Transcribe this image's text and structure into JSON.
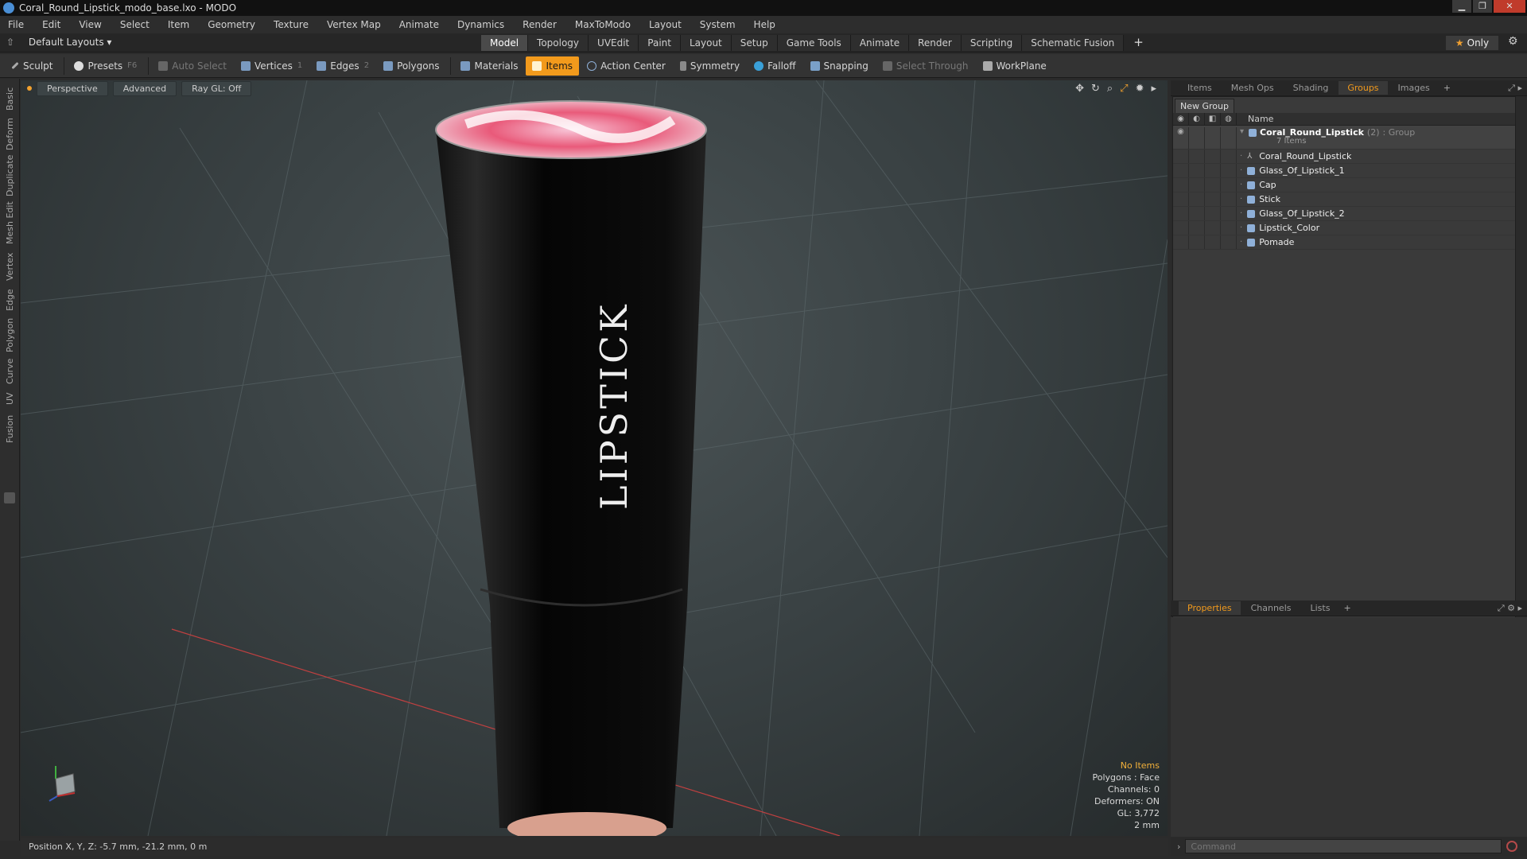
{
  "window": {
    "title": "Coral_Round_Lipstick_modo_base.lxo - MODO",
    "controls": [
      "▁",
      "❐",
      "✕"
    ]
  },
  "menu": [
    "File",
    "Edit",
    "View",
    "Select",
    "Item",
    "Geometry",
    "Texture",
    "Vertex Map",
    "Animate",
    "Dynamics",
    "Render",
    "MaxToModo",
    "Layout",
    "System",
    "Help"
  ],
  "layout": {
    "selector": "Default Layouts ▾",
    "tabs": [
      "Model",
      "Topology",
      "UVEdit",
      "Paint",
      "Layout",
      "Setup",
      "Game Tools",
      "Animate",
      "Render",
      "Scripting",
      "Schematic Fusion"
    ],
    "active_tab": "Model",
    "plus": "+",
    "only": "Only"
  },
  "toolbar": {
    "sculpt": "Sculpt",
    "presets": "Presets",
    "presets_key": "F6",
    "auto_select": "Auto Select",
    "vertices": "Vertices",
    "vertices_count": "1",
    "edges": "Edges",
    "edges_count": "2",
    "polygons": "Polygons",
    "materials": "Materials",
    "items": "Items",
    "action_center": "Action Center",
    "symmetry": "Symmetry",
    "falloff": "Falloff",
    "snapping": "Snapping",
    "select_through": "Select Through",
    "workplane": "WorkPlane"
  },
  "left_tabs": [
    "Basic",
    "Deform",
    "Duplicate",
    "Mesh Edit",
    "Vertex",
    "Edge",
    "Polygon",
    "Curve",
    "UV",
    "Fusion"
  ],
  "viewport": {
    "view": "Perspective",
    "shading": "Advanced",
    "raygl": "Ray GL: Off",
    "label_text": "LIPSTICK",
    "info": {
      "items": "No Items",
      "polygons": "Polygons : Face",
      "channels": "Channels: 0",
      "deformers": "Deformers: ON",
      "gl": "GL: 3,772",
      "scale": "2 mm"
    }
  },
  "status": {
    "position": "Position X, Y, Z:  -5.7 mm, -21.2 mm, 0 m"
  },
  "right_panel": {
    "tabs": [
      "Items",
      "Mesh Ops",
      "Shading",
      "Groups",
      "Images"
    ],
    "active_tab": "Groups",
    "new_group": "New Group",
    "col_name": "Name",
    "group": {
      "name": "Coral_Round_Lipstick",
      "count": "(2)",
      "type": ": Group",
      "sub": "7 Items"
    },
    "children": [
      "Coral_Round_Lipstick",
      "Glass_Of_Lipstick_1",
      "Cap",
      "Stick",
      "Glass_Of_Lipstick_2",
      "Lipstick_Color",
      "Pomade"
    ],
    "bottom_tabs": [
      "Properties",
      "Channels",
      "Lists"
    ],
    "bottom_active": "Properties"
  },
  "command": {
    "placeholder": "Command"
  },
  "colors": {
    "accent": "#f29a1c",
    "viewport_bg": "#3a4244",
    "mesh_icon": "#8fb0d8"
  }
}
